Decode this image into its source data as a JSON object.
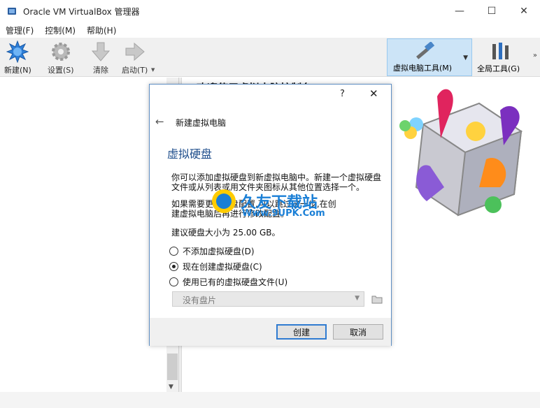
{
  "window": {
    "title": "Oracle VM VirtualBox 管理器",
    "minimize": "—",
    "maximize": "☐",
    "close": "✕"
  },
  "menubar": {
    "items": [
      "管理(F)",
      "控制(M)",
      "帮助(H)"
    ]
  },
  "toolbar": {
    "new_label": "新建(N)",
    "settings_label": "设置(S)",
    "discard_label": "清除",
    "start_label": "启动(T)",
    "machine_tools_label": "虚拟电脑工具(M)",
    "global_tools_label": "全局工具(G)"
  },
  "welcome": {
    "heading": "欢迎使用虚拟电脑控制台!"
  },
  "dialog": {
    "help": "?",
    "close": "✕",
    "back": "←",
    "wizard_title": "新建虚拟电脑",
    "page_heading": "虚拟硬盘",
    "intro_line1": "你可以添加虚拟硬盘到新虚拟电脑中。新建一个虚拟硬盘",
    "intro_line2": "文件或从列表或用文件夹图标从其他位置选择一个。",
    "advice_line1": "如果需要更多硬盘配置,可以跳过这一步,在创",
    "advice_line2": "建虚拟电脑后再进行修改配置。",
    "recommend": "建议硬盘大小为 25.00 GB。",
    "option_none": "不添加虚拟硬盘(D)",
    "option_create": "现在创建虚拟硬盘(C)",
    "option_existing": "使用已有的虚拟硬盘文件(U)",
    "selected_option": "create",
    "disk_select_value": "没有盘片",
    "create_button": "创建",
    "cancel_button": "取消"
  },
  "watermark": {
    "brand": "久友下载站",
    "url": "Www.9UPK.Com"
  },
  "colors": {
    "accent": "#2f7bd1",
    "heading_blue": "#1f4e8c",
    "tool_selected_bg": "#cce4f7"
  }
}
